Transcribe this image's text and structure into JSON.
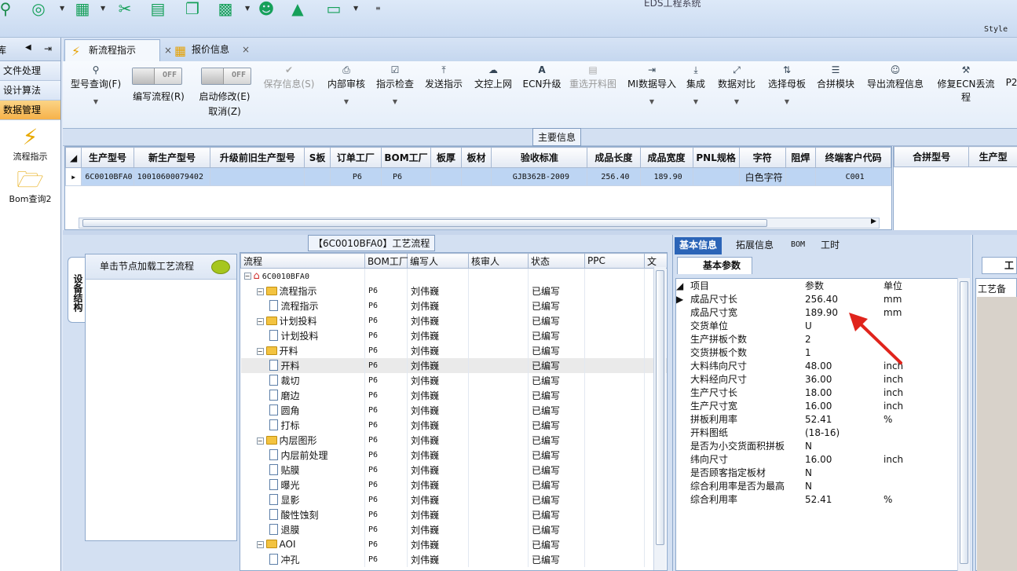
{
  "app": {
    "title": "EDS工程系统",
    "style_label": "Style"
  },
  "left_nav": {
    "top_label": "库",
    "items": [
      {
        "label": "文件处理"
      },
      {
        "label": "设计算法"
      },
      {
        "label": "数据管理",
        "active": true
      }
    ],
    "icons": [
      {
        "label": "流程指示",
        "icon": "lightning-icon"
      },
      {
        "label": "Bom查询2",
        "icon": "folder-icon"
      }
    ]
  },
  "tabs": [
    {
      "label": "新流程指示",
      "selected": true
    },
    {
      "label": "报价信息",
      "selected": false
    }
  ],
  "ribbon": {
    "buttons": [
      {
        "label": "型号查询(F)",
        "icon": "search-icon"
      },
      {
        "label": "编写流程(R)",
        "toggle": "OFF"
      },
      {
        "label": "启动修改(E)",
        "sub": "取消(Z)",
        "toggle": "OFF"
      },
      {
        "label": "保存信息(S)",
        "disabled": true,
        "icon": "check-icon"
      },
      {
        "label": "内部审核",
        "icon": "print-icon"
      },
      {
        "label": "指示检查",
        "icon": "checkbox-icon"
      },
      {
        "label": "发送指示",
        "icon": "upload-icon"
      },
      {
        "label": "文控上网",
        "icon": "cloud-icon"
      },
      {
        "label": "ECN升级",
        "icon": "a-icon"
      },
      {
        "label": "重选开料图",
        "disabled": true,
        "icon": "image-icon"
      },
      {
        "label": "MI数据导入",
        "icon": "import-icon"
      },
      {
        "label": "集成",
        "icon": "download-icon"
      },
      {
        "label": "数据对比",
        "icon": "compare-icon"
      },
      {
        "label": "选择母板",
        "icon": "shuffle-icon"
      },
      {
        "label": "合拼模块",
        "icon": "list-icon"
      },
      {
        "label": "导出流程信息",
        "icon": "smile-icon"
      },
      {
        "label": "修复ECN丢流程",
        "icon": "wrench-icon"
      },
      {
        "label": "P2",
        "icon": ""
      }
    ]
  },
  "main_info": {
    "title": "主要信息",
    "columns": [
      "生产型号",
      "新生产型号",
      "升级前旧生产型号",
      "S板",
      "订单工厂",
      "BOM工厂",
      "板厚",
      "板材",
      "验收标准",
      "成品长度",
      "成品宽度",
      "PNL规格",
      "字符",
      "阻焊",
      "终端客户代码"
    ],
    "rows": [
      [
        "6C0010BFA0",
        "10010600079402",
        "",
        "",
        "P6",
        "P6",
        "",
        "",
        "GJB362B-2009",
        "256.40",
        "189.90",
        "",
        "白色字符",
        "",
        "C001"
      ]
    ],
    "right_columns": [
      "合拼型号",
      "生产型"
    ]
  },
  "process": {
    "title": "【6C0010BFA0】工艺流程",
    "side_tab": "设备结构",
    "hint": "单击节点加载工艺流程",
    "columns": [
      "流程",
      "BOM工厂",
      "编写人",
      "核审人",
      "状态",
      "PPC",
      "文"
    ],
    "rows": [
      {
        "name": "6C0010BFA0",
        "level": 0,
        "type": "root",
        "factory": "",
        "writer": "",
        "status": ""
      },
      {
        "name": "流程指示",
        "level": 1,
        "type": "folder",
        "factory": "P6",
        "writer": "刘伟巍",
        "status": "已编写"
      },
      {
        "name": "流程指示",
        "level": 2,
        "type": "doc",
        "factory": "P6",
        "writer": "刘伟巍",
        "status": "已编写"
      },
      {
        "name": "计划投料",
        "level": 1,
        "type": "folder",
        "factory": "P6",
        "writer": "刘伟巍",
        "status": "已编写"
      },
      {
        "name": "计划投料",
        "level": 2,
        "type": "doc",
        "factory": "P6",
        "writer": "刘伟巍",
        "status": "已编写"
      },
      {
        "name": "开料",
        "level": 1,
        "type": "folder",
        "factory": "P6",
        "writer": "刘伟巍",
        "status": "已编写"
      },
      {
        "name": "开料",
        "level": 2,
        "type": "doc",
        "factory": "P6",
        "writer": "刘伟巍",
        "status": "已编写",
        "selected": true
      },
      {
        "name": "裁切",
        "level": 2,
        "type": "doc",
        "factory": "P6",
        "writer": "刘伟巍",
        "status": "已编写"
      },
      {
        "name": "磨边",
        "level": 2,
        "type": "doc",
        "factory": "P6",
        "writer": "刘伟巍",
        "status": "已编写"
      },
      {
        "name": "圆角",
        "level": 2,
        "type": "doc",
        "factory": "P6",
        "writer": "刘伟巍",
        "status": "已编写"
      },
      {
        "name": "打标",
        "level": 2,
        "type": "doc",
        "factory": "P6",
        "writer": "刘伟巍",
        "status": "已编写"
      },
      {
        "name": "内层图形",
        "level": 1,
        "type": "folder",
        "factory": "P6",
        "writer": "刘伟巍",
        "status": "已编写"
      },
      {
        "name": "内层前处理",
        "level": 2,
        "type": "doc",
        "factory": "P6",
        "writer": "刘伟巍",
        "status": "已编写"
      },
      {
        "name": "贴膜",
        "level": 2,
        "type": "doc",
        "factory": "P6",
        "writer": "刘伟巍",
        "status": "已编写"
      },
      {
        "name": "曝光",
        "level": 2,
        "type": "doc",
        "factory": "P6",
        "writer": "刘伟巍",
        "status": "已编写"
      },
      {
        "name": "显影",
        "level": 2,
        "type": "doc",
        "factory": "P6",
        "writer": "刘伟巍",
        "status": "已编写"
      },
      {
        "name": "酸性蚀刻",
        "level": 2,
        "type": "doc",
        "factory": "P6",
        "writer": "刘伟巍",
        "status": "已编写"
      },
      {
        "name": "退膜",
        "level": 2,
        "type": "doc",
        "factory": "P6",
        "writer": "刘伟巍",
        "status": "已编写"
      },
      {
        "name": "AOI",
        "level": 1,
        "type": "folder",
        "factory": "P6",
        "writer": "刘伟巍",
        "status": "已编写"
      },
      {
        "name": "冲孔",
        "level": 2,
        "type": "doc",
        "factory": "P6",
        "writer": "刘伟巍",
        "status": "已编写"
      }
    ]
  },
  "props": {
    "tabs": [
      "基本信息",
      "拓展信息",
      "BOM",
      "工时"
    ],
    "subtab": "基本参数",
    "columns": [
      "项目",
      "参数",
      "单位"
    ],
    "rows": [
      {
        "name": "成品尺寸长",
        "value": "256.40",
        "unit": "mm",
        "pink": true,
        "selected": true
      },
      {
        "name": "成品尺寸宽",
        "value": "189.90",
        "unit": "mm",
        "pink": true
      },
      {
        "name": "交货单位",
        "value": "U",
        "unit": "",
        "pink": true
      },
      {
        "name": "生产拼板个数",
        "value": "2",
        "unit": "",
        "pink": true
      },
      {
        "name": "交货拼板个数",
        "value": "1",
        "unit": "",
        "pink": true
      },
      {
        "name": "大料纬向尺寸",
        "value": "48.00",
        "unit": "inch",
        "pink": true
      },
      {
        "name": "大料经向尺寸",
        "value": "36.00",
        "unit": "inch",
        "pink": true
      },
      {
        "name": "生产尺寸长",
        "value": "18.00",
        "unit": "inch",
        "pink": true
      },
      {
        "name": "生产尺寸宽",
        "value": "16.00",
        "unit": "inch",
        "pink": true
      },
      {
        "name": "拼板利用率",
        "value": "52.41",
        "unit": "%",
        "pink": true
      },
      {
        "name": "开料图纸",
        "value": "(18-16)",
        "unit": "",
        "pink": false
      },
      {
        "name": "是否为小交货面积拼板",
        "value": "N",
        "unit": "",
        "pink": false
      },
      {
        "name": "纬向尺寸",
        "value": "16.00",
        "unit": "inch",
        "pink": true
      },
      {
        "name": "是否顾客指定板材",
        "value": "N",
        "unit": "",
        "pink": true
      },
      {
        "name": "综合利用率是否为最高",
        "value": "N",
        "unit": "",
        "pink": false
      },
      {
        "name": "综合利用率",
        "value": "52.41",
        "unit": "%",
        "pink": true
      }
    ]
  },
  "far_right": {
    "tab": "工艺",
    "label": "工艺备注"
  }
}
